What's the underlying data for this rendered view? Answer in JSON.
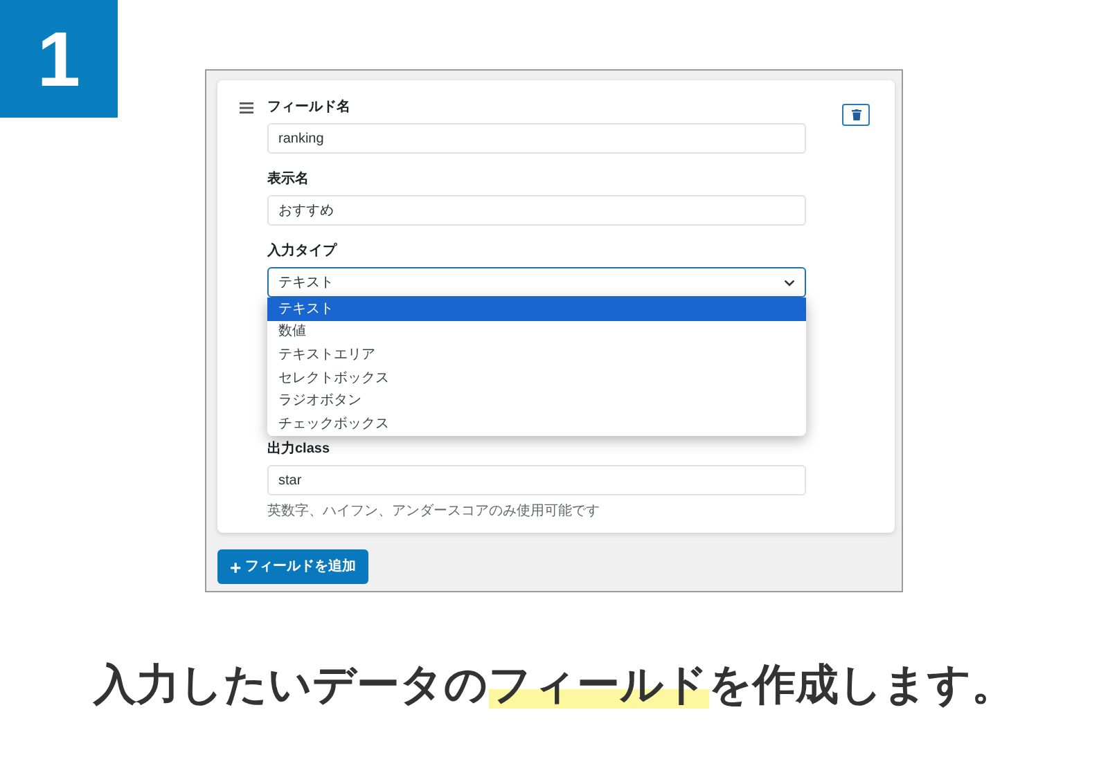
{
  "step_number": "1",
  "form": {
    "fields": [
      {
        "label": "フィールド名",
        "value": "ranking",
        "kind": "text"
      },
      {
        "label": "表示名",
        "value": "おすすめ",
        "kind": "text"
      },
      {
        "label": "入力タイプ",
        "value": "テキスト",
        "kind": "select",
        "expanded": true,
        "options": [
          {
            "label": "テキスト",
            "selected": true
          },
          {
            "label": "数値",
            "selected": false
          },
          {
            "label": "テキストエリア",
            "selected": false
          },
          {
            "label": "セレクトボックス",
            "selected": false
          },
          {
            "label": "ラジオボタン",
            "selected": false
          },
          {
            "label": "チェックボックス",
            "selected": false
          }
        ]
      },
      {
        "label": "出力class",
        "value": "star",
        "kind": "text",
        "help": "英数字、ハイフン、アンダースコアのみ使用可能です"
      }
    ]
  },
  "add_button": {
    "icon": "+",
    "label": "フィールドを追加"
  },
  "caption": {
    "before": "入力したいデータの",
    "highlight": "フィールド",
    "after": "を作成します。"
  }
}
